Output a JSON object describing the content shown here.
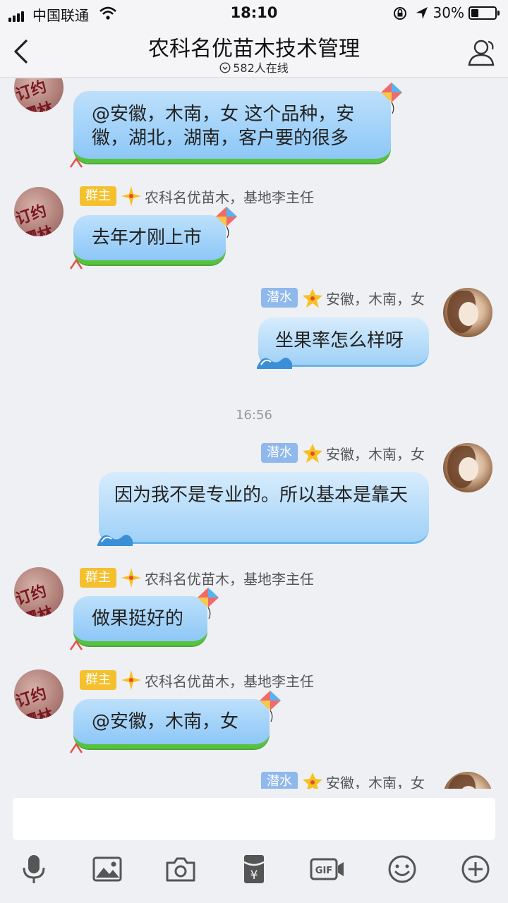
{
  "status_bar": {
    "carrier": "中国联通",
    "time": "18:10",
    "battery_pct": "30%"
  },
  "header": {
    "title": "农科名优苗木技术管理",
    "online": "582人在线"
  },
  "messages": [
    {
      "side": "left",
      "badge": "群主",
      "name": "农科名优苗木，基地李主任",
      "text": "@安徽，木南，女 这个品种，安徽，湖北，湖南，客户要的很多"
    },
    {
      "side": "left",
      "badge": "群主",
      "name": "农科名优苗木，基地李主任",
      "text": "去年才刚上市"
    },
    {
      "side": "right",
      "badge": "潜水",
      "name": "安徽，木南，女",
      "text": "坐果率怎么样呀"
    },
    {
      "side": "right",
      "badge": "潜水",
      "name": "安徽，木南，女",
      "text": "因为我不是专业的。所以基本是靠天"
    },
    {
      "side": "left",
      "badge": "群主",
      "name": "农科名优苗木，基地李主任",
      "text": "做果挺好的"
    },
    {
      "side": "left",
      "badge": "群主",
      "name": "农科名优苗木，基地李主任",
      "text": "@安徽，木南，女"
    },
    {
      "side": "right",
      "badge": "潜水",
      "name": "安徽，木南，女",
      "text": ""
    }
  ],
  "timestamp": "16:56",
  "avatar_text": "订约樱林",
  "input": {
    "value": "",
    "placeholder": ""
  },
  "toolbar": {
    "icons": [
      "microphone-icon",
      "image-icon",
      "camera-icon",
      "red-packet-icon",
      "gif-icon",
      "emoji-icon",
      "plus-icon"
    ],
    "gif_label": "GIF",
    "yen_label": "¥"
  },
  "colors": {
    "owner_badge": "#f4c02e",
    "diver_badge": "#8fb8ec",
    "left_bubble": "#8dc7f7",
    "right_bubble": "#9fd1f7",
    "grass": "#56c23f"
  }
}
